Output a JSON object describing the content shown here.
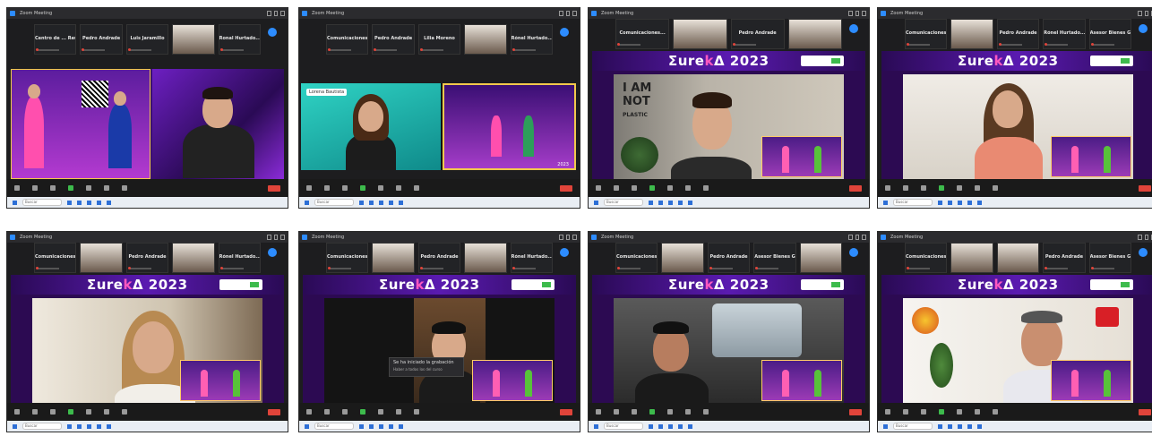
{
  "collage": {
    "tiles": [
      {
        "window_title": "Zoom Meeting",
        "participants": [
          "Centro de ... Reunión",
          "Pedro Andrade",
          "Luis Jaramillo",
          "",
          "Ronal Hurtado..."
        ],
        "stage_label": "",
        "taskbar_search": "Buscar"
      },
      {
        "window_title": "Zoom Meeting",
        "participants": [
          "Comunicaciones...",
          "Pedro Andrade",
          "Lilia Moreno",
          "",
          "Rónel Hurtado..."
        ],
        "stage_label": "Lorena Bautista",
        "pip_caption": "2023",
        "taskbar_search": "Buscar"
      },
      {
        "window_title": "Zoom Meeting",
        "participants": [
          "Comunicaciones...",
          "",
          "Pedro Andrade",
          "",
          ""
        ],
        "brand": {
          "prefix": "Σure",
          "mid": "k",
          "suffix": "Δ 2023"
        },
        "stage_label": "",
        "poster": [
          "I AM",
          "NOT",
          "PLASTIC"
        ],
        "taskbar_search": "Buscar"
      },
      {
        "window_title": "Zoom Meeting",
        "participants": [
          "Comunicaciones...",
          "",
          "Pedro Andrade",
          "Rónel Hurtado...",
          "Asesor Bienes G..."
        ],
        "brand": {
          "prefix": "Σure",
          "mid": "k",
          "suffix": "Δ 2023"
        },
        "taskbar_search": "Buscar"
      },
      {
        "window_title": "Zoom Meeting",
        "participants": [
          "Comunicaciones...",
          "",
          "Pedro Andrade",
          "",
          "Rónel Hurtado..."
        ],
        "brand": {
          "prefix": "Σure",
          "mid": "k",
          "suffix": "Δ 2023"
        },
        "taskbar_search": "Buscar"
      },
      {
        "window_title": "Zoom Meeting",
        "participants": [
          "Comunicaciones...",
          "",
          "Pedro Andrade",
          "",
          "Rónel Hurtado..."
        ],
        "brand": {
          "prefix": "Σure",
          "mid": "k",
          "suffix": "Δ 2023"
        },
        "notification": {
          "title": "Se ha iniciado la grabación",
          "body": "Haber a todos los del curso"
        },
        "taskbar_search": "Buscar"
      },
      {
        "window_title": "Zoom Meeting",
        "participants": [
          "Comunicaciones...",
          "",
          "Pedro Andrade",
          "Asesor Bienes G...",
          ""
        ],
        "brand": {
          "prefix": "Σure",
          "mid": "k",
          "suffix": "Δ 2023"
        },
        "taskbar_search": "Buscar"
      },
      {
        "window_title": "Zoom Meeting",
        "participants": [
          "Comunicaciones...",
          "",
          "",
          "Pedro Andrade",
          "Asesor Bienes G..."
        ],
        "brand": {
          "prefix": "Σure",
          "mid": "k",
          "suffix": "Δ 2023"
        },
        "taskbar_search": "Buscar"
      }
    ]
  },
  "colors": {
    "stage_purple": "#2c0a52",
    "brand_pink": "#ff58c0",
    "zoom_blue": "#2d8cff",
    "end_red": "#e0443a",
    "unmute_green": "#3dbb4c"
  }
}
